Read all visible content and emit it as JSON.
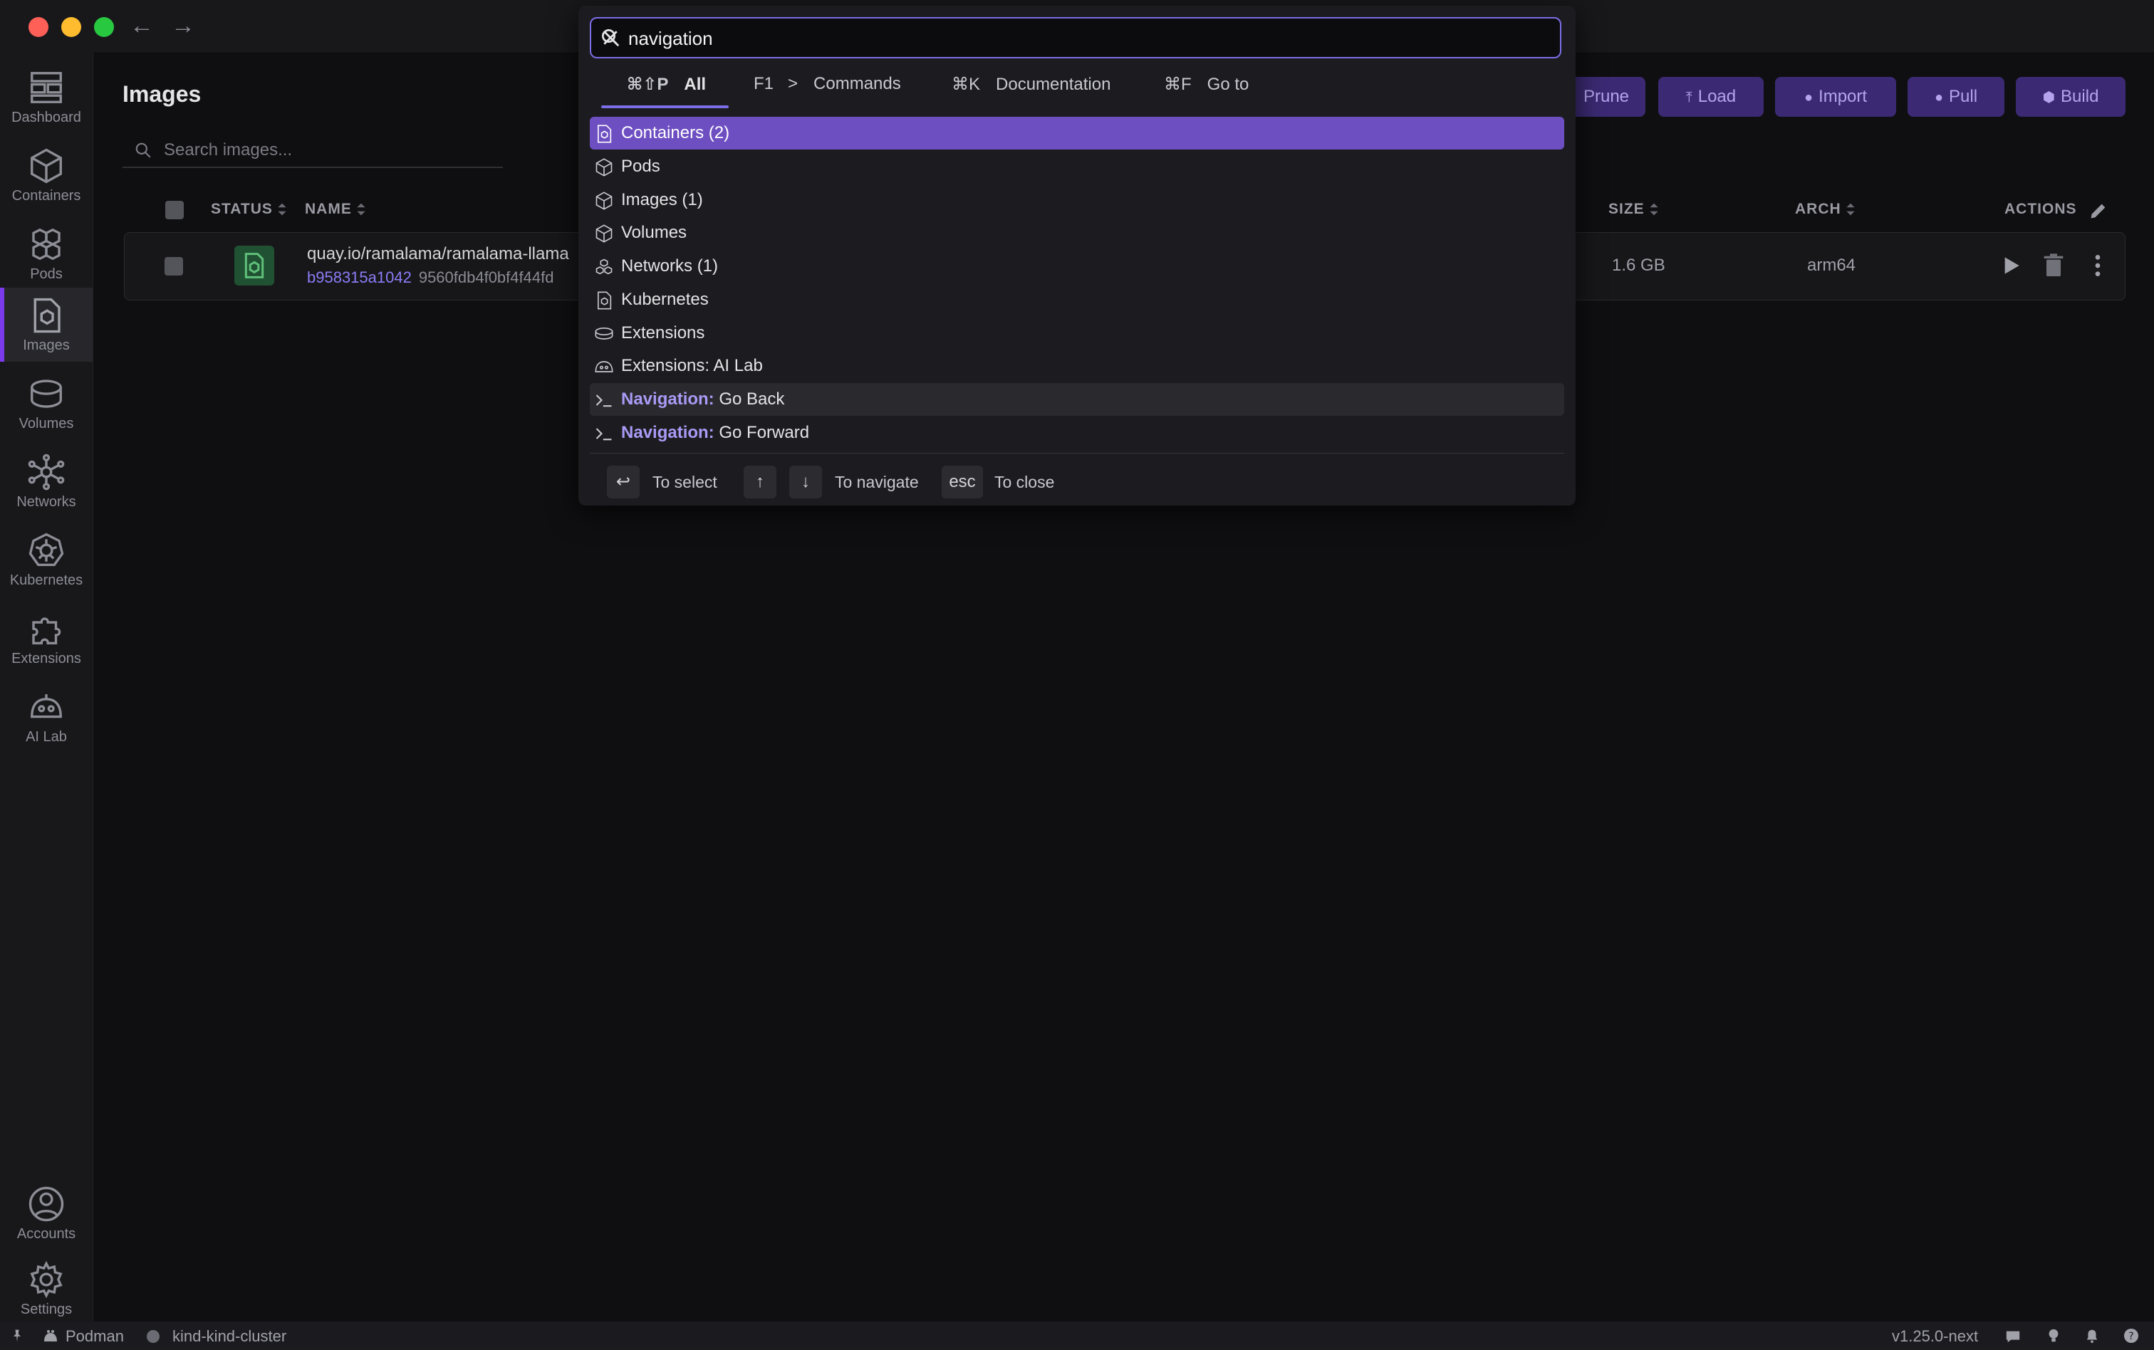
{
  "window": {
    "back_icon": "arrow-left-icon",
    "forward_icon": "arrow-right-icon"
  },
  "sidebar": {
    "items": [
      {
        "label": "Dashboard",
        "icon": "dashboard-icon"
      },
      {
        "label": "Containers",
        "icon": "container-icon"
      },
      {
        "label": "Pods",
        "icon": "pods-icon"
      },
      {
        "label": "Images",
        "icon": "image-icon",
        "active": true
      },
      {
        "label": "Volumes",
        "icon": "volume-icon"
      },
      {
        "label": "Networks",
        "icon": "network-icon"
      },
      {
        "label": "Kubernetes",
        "icon": "kubernetes-icon"
      },
      {
        "label": "Extensions",
        "icon": "puzzle-icon"
      },
      {
        "label": "AI Lab",
        "icon": "robot-icon"
      }
    ],
    "bottom": [
      {
        "label": "Accounts",
        "icon": "account-icon"
      },
      {
        "label": "Settings",
        "icon": "gear-icon"
      }
    ]
  },
  "page": {
    "title": "Images",
    "search_placeholder": "Search images...",
    "toolbar": {
      "prune": "Prune",
      "load": "Load",
      "import": "Import",
      "pull": "Pull",
      "build": "Build"
    },
    "table": {
      "headers": {
        "status": "STATUS",
        "name": "NAME",
        "size": "SIZE",
        "arch": "ARCH",
        "actions": "ACTIONS"
      },
      "rows": [
        {
          "name": "quay.io/ramalama/ramalama-llama",
          "short_id": "b958315a1042",
          "digest": "9560fdb4f0bf4f44fd",
          "size": "1.6 GB",
          "arch": "arm64"
        }
      ]
    }
  },
  "palette": {
    "query": "navigation",
    "tabs": [
      {
        "key": "⌘⇧P",
        "label": "All",
        "active": true
      },
      {
        "key": "F1   >",
        "label": "Commands"
      },
      {
        "key": "⌘K",
        "label": "Documentation"
      },
      {
        "key": "⌘F",
        "label": "Go to"
      }
    ],
    "items": [
      {
        "text": "Containers (2)",
        "icon": "container-icon",
        "state": "selected"
      },
      {
        "text": "Pods",
        "icon": "cube-icon"
      },
      {
        "text": "Images (1)",
        "icon": "cube-icon"
      },
      {
        "text": "Volumes",
        "icon": "cube-icon"
      },
      {
        "text": "Networks (1)",
        "icon": "network-icon"
      },
      {
        "text": "Kubernetes",
        "icon": "container-icon"
      },
      {
        "text": "Extensions",
        "icon": "disk-icon"
      },
      {
        "text": "Extensions: AI Lab",
        "icon": "robot-icon"
      },
      {
        "prefix": "Navigation:",
        "text": " Go Back",
        "icon": "terminal-icon",
        "state": "hover"
      },
      {
        "prefix": "Navigation:",
        "text": " Go Forward",
        "icon": "terminal-icon"
      }
    ],
    "footer": {
      "enter_key": "↩",
      "select": "To select",
      "up_key": "↑",
      "down_key": "↓",
      "navigate": "To navigate",
      "esc_key": "esc",
      "close": "To close"
    }
  },
  "statusbar": {
    "engine": "Podman",
    "cluster": "kind-kind-cluster",
    "version": "v1.25.0-next"
  },
  "colors": {
    "accent": "#7c6ee6",
    "selected": "#6d4fc2",
    "button": "#3b2a73"
  }
}
